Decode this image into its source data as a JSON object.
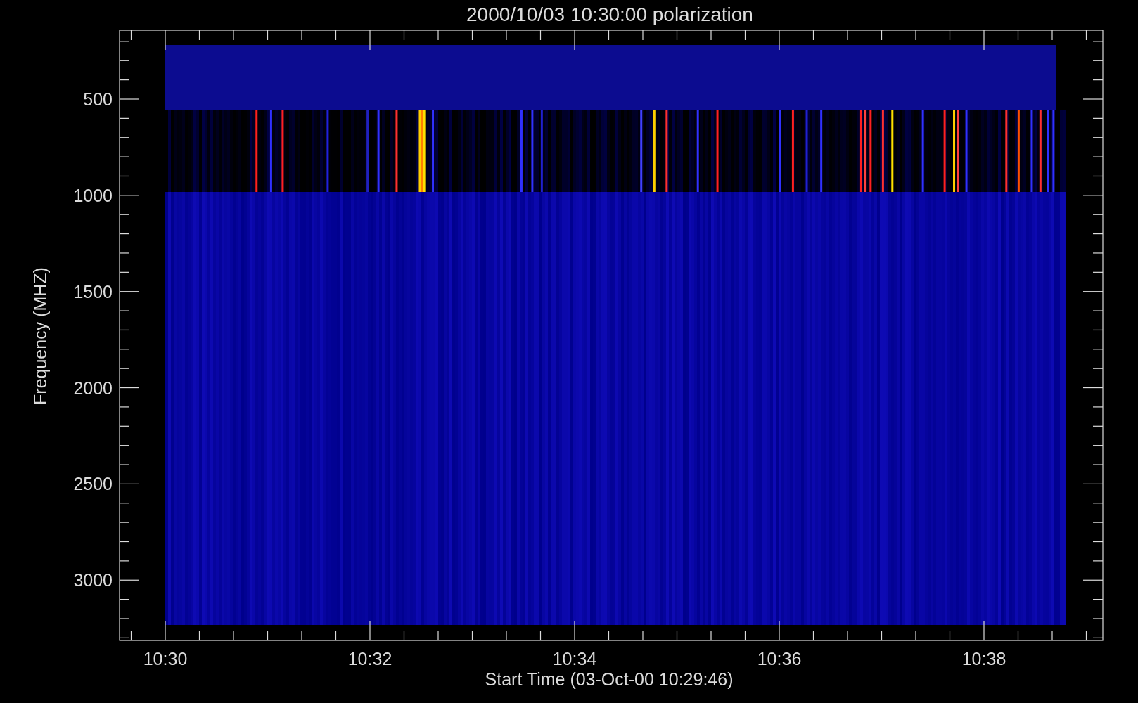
{
  "plot": {
    "title": "2000/10/03 10:30:00 polarization",
    "xlabel": "Start Time (03-Oct-00 10:29:46)",
    "ylabel": "Frequency (MHZ)",
    "x_tick_labels": [
      "10:30",
      "10:32",
      "10:34",
      "10:36",
      "10:38"
    ],
    "y_tick_labels": [
      "500",
      "1000",
      "1500",
      "2000",
      "2500",
      "3000"
    ]
  }
}
